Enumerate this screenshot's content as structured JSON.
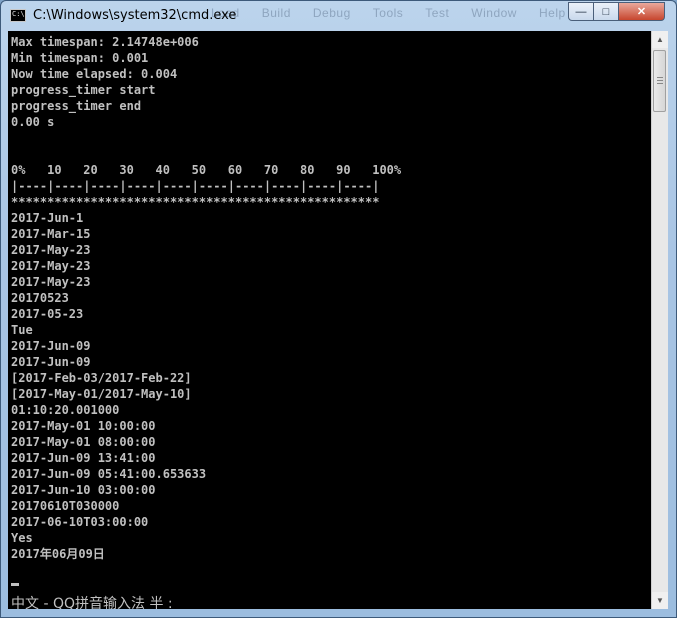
{
  "window": {
    "title": "C:\\Windows\\system32\\cmd.exe",
    "ghost_menu": [
      "Load",
      "Build",
      "Debug",
      "Tools",
      "Test",
      "Window",
      "Help"
    ]
  },
  "controls": {
    "minimize": "—",
    "maximize": "□",
    "close": "✕"
  },
  "console": {
    "background": "#000000",
    "foreground": "#c0c0c0",
    "lines": [
      "Max timespan: 2.14748e+006",
      "Min timespan: 0.001",
      "Now time elapsed: 0.004",
      "progress_timer start",
      "progress_timer end",
      "0.00 s",
      "",
      "",
      "0%   10   20   30   40   50   60   70   80   90   100%",
      "|----|----|----|----|----|----|----|----|----|----|",
      "***************************************************",
      "2017-Jun-1",
      "2017-Mar-15",
      "2017-May-23",
      "2017-May-23",
      "2017-May-23",
      "20170523",
      "2017-05-23",
      "Tue",
      "2017-Jun-09",
      "2017-Jun-09",
      "[2017-Feb-03/2017-Feb-22]",
      "[2017-May-01/2017-May-10]",
      "01:10:20.001000",
      "2017-May-01 10:00:00",
      "2017-May-01 08:00:00",
      "2017-Jun-09 13:41:00",
      "2017-Jun-09 05:41:00.653633",
      "2017-Jun-10 03:00:00",
      "20170610T030000",
      "2017-06-10T03:00:00",
      "Yes",
      "2017年06月09日"
    ],
    "ime_status": "中文 - QQ拼音输入法 半 :"
  },
  "scrollbar": {
    "up_arrow": "▲",
    "down_arrow": "▼"
  }
}
